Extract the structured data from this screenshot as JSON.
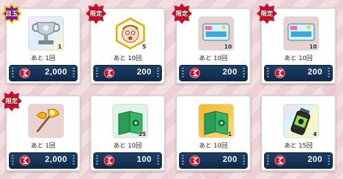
{
  "colors": {
    "accent_red": "#c8102e",
    "gold_badge": "#f6c700",
    "price_bg": "#163659"
  },
  "items": [
    {
      "badge": "目玉",
      "badge_color": "#7b1fa2",
      "icon": "silver-trophy-medal-icon",
      "quantity": "1",
      "remaining": "あと 1回",
      "price": "2,000",
      "currency_icon": "red-coin-icon"
    },
    {
      "badge": "限定",
      "badge_color": "#c8102e",
      "icon": "character-face-icon",
      "quantity": "5",
      "remaining": "あと 10回",
      "price": "200",
      "currency_icon": "red-coin-icon"
    },
    {
      "badge": "限定",
      "badge_color": "#c8102e",
      "icon": "gacha-ticket-icon",
      "quantity": "10",
      "remaining": "あと 10回",
      "price": "200",
      "currency_icon": "red-coin-icon"
    },
    {
      "badge": "限定",
      "badge_color": "#c8102e",
      "icon": "gacha-ticket-icon",
      "quantity": "10",
      "remaining": "あと 10回",
      "price": "200",
      "currency_icon": "red-coin-icon"
    },
    {
      "badge": "限定",
      "badge_color": "#c8102e",
      "icon": "golden-axe-icon",
      "quantity": "",
      "remaining": "あと 1回",
      "price": "2,000",
      "currency_icon": "red-coin-icon"
    },
    {
      "badge": "",
      "badge_color": "",
      "icon": "green-book-icon",
      "quantity": "25",
      "remaining": "あと 10回",
      "price": "100",
      "currency_icon": "red-coin-icon"
    },
    {
      "badge": "",
      "badge_color": "",
      "icon": "green-book-gold-frame-icon",
      "quantity": "1",
      "remaining": "あと 10回",
      "price": "200",
      "currency_icon": "red-coin-icon"
    },
    {
      "badge": "",
      "badge_color": "",
      "icon": "green-drink-bottle-icon",
      "quantity": "4",
      "remaining": "あと 15回",
      "price": "200",
      "currency_icon": "red-coin-icon"
    }
  ]
}
